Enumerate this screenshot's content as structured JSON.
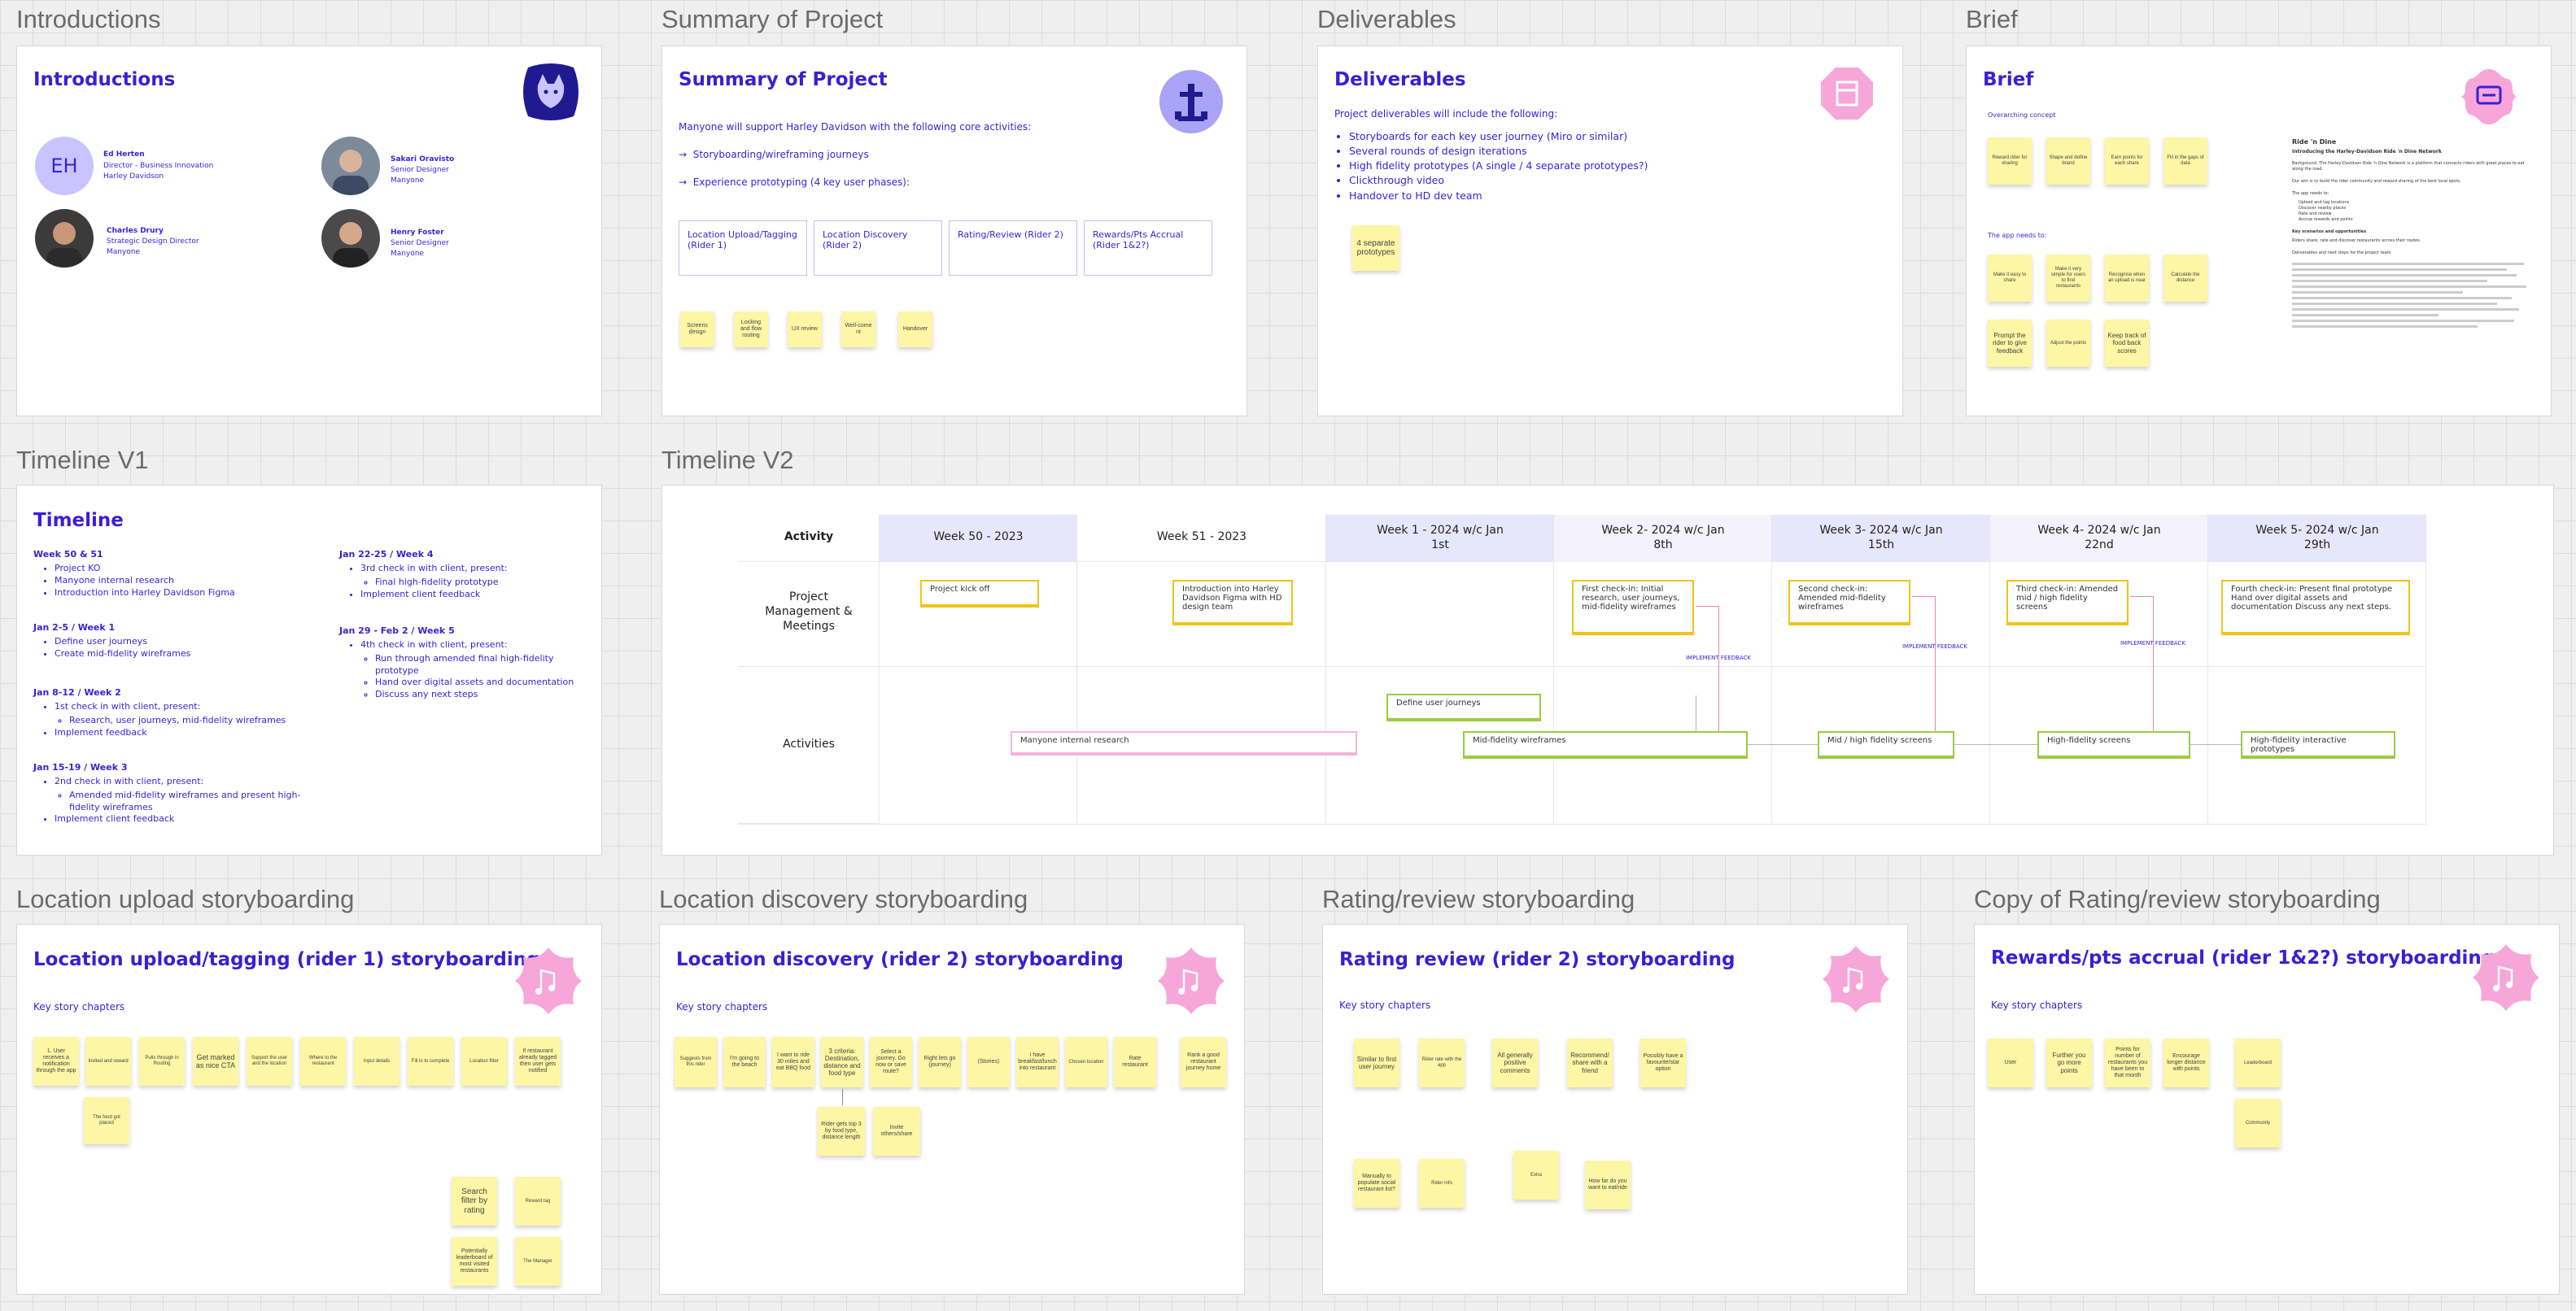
{
  "frames": {
    "intro": {
      "title": "Introductions",
      "heading": "Introductions",
      "people": [
        {
          "initials": "EH",
          "name": "Ed Herten",
          "role": "Director - Business Innovation",
          "org": "Harley Davidson"
        },
        {
          "name": "Sakari Oravisto",
          "role": "Senior Designer",
          "org": "Manyone"
        },
        {
          "name": "Charles Drury",
          "role": "Strategic Design Director",
          "org": "Manyone"
        },
        {
          "name": "Henry Foster",
          "role": "Senior Designer",
          "org": "Manyone"
        }
      ]
    },
    "summary": {
      "title": "Summary of Project",
      "heading": "Summary of Project",
      "lead": "Manyone will support Harley Davidson with the following core activities:",
      "arrows": [
        "Storyboarding/wireframing journeys",
        "Experience prototyping (4 key user phases):"
      ],
      "arrow_glyph": "→",
      "phases": [
        "Location Upload/Tagging (Rider 1)",
        "Location Discovery (Rider 2)",
        "Rating/Review (Rider 2)",
        "Rewards/Pts Accrual (Rider 1&2?)"
      ],
      "stickies": [
        "Screens design",
        "Locking and flow routing",
        "UX review",
        "Well-come nt",
        "Handover"
      ]
    },
    "deliverables": {
      "title": "Deliverables",
      "heading": "Deliverables",
      "lead": "Project deliverables will include the following:",
      "bullets": [
        "Storyboards for each key user journey (Miro or similar)",
        "Several rounds of design iterations",
        "High fidelity prototypes (A single / 4 separate prototypes?)",
        "Clickthrough video",
        "Handover to HD dev team"
      ],
      "sticky": "4 separate prototypes"
    },
    "brief": {
      "title": "Brief",
      "heading": "Brief",
      "concept_label": "Overarching concept",
      "needs_label": "The app needs to:",
      "stickies": [
        "Reward rider for sharing",
        "Shape and define brand",
        "Earn points for each share",
        "Fill in the gaps of data",
        "Make it easy to share",
        "Make it very simple for users to find restaurants",
        "Recognise when an upload is near",
        "Calculate the distance",
        "Prompt the rider to give feedback",
        "Adjust the points",
        "Keep track of food back scores"
      ],
      "doc_title": "Ride 'n Dine",
      "doc_subtitle": "Introducing the Harley-Davidson Ride 'n Dine Network",
      "doc_lines": [
        "Background: The Harley-Davidson Ride 'n Dine Network is a platform that connects riders with great places to eat along the road.",
        "Our aim is to build the rider community and reward sharing of the best local spots.",
        "The app needs to:",
        "Upload and tag locations",
        "Discover nearby places",
        "Rate and review",
        "Accrue rewards and points",
        "Key scenarios and opportunities",
        "Riders share, rate and discover restaurants across their routes.",
        "Deliverables and next steps for the project team."
      ]
    },
    "timeline1": {
      "title": "Timeline V1",
      "heading": "Timeline",
      "sections": [
        {
          "head": "Week 50 & 51",
          "items": [
            "Project KO",
            "Manyone internal research",
            "Introduction into Harley Davidson Figma"
          ]
        },
        {
          "head": "Jan 2-5 / Week 1",
          "items": [
            "Define user journeys",
            "Create mid-fidelity wireframes"
          ]
        },
        {
          "head": "Jan 8-12 / Week 2",
          "items": [
            "1st check in with client, present:",
            "Research, user journeys, mid-fidelity wireframes",
            "Implement feedback"
          ]
        },
        {
          "head": "Jan 15-19 / Week 3",
          "items": [
            "2nd check in with client, present:",
            "Amended mid-fidelity wireframes and present high-fidelity wireframes",
            "Implement client feedback"
          ]
        },
        {
          "head": "Jan 22-25 / Week 4",
          "items": [
            "3rd check in with client, present:",
            "Final high-fidelity prototype",
            "Implement client feedback"
          ]
        },
        {
          "head": "Jan 29 - Feb 2 / Week 5",
          "items": [
            "4th check in with client, present:",
            "Run through amended final high-fidelity prototype",
            "Hand over digital assets and documentation",
            "Discuss any next steps"
          ]
        }
      ]
    },
    "timeline2": {
      "title": "Timeline V2",
      "columns": [
        "Activity",
        "Week 50 - 2023",
        "Week 51 - 2023",
        "Week 1 - 2024 w/c Jan 1st",
        "Week 2- 2024 w/c Jan 8th",
        "Week 3- 2024 w/c Jan 15th",
        "Week 4- 2024 w/c Jan 22nd",
        "Week 5- 2024 w/c Jan 29th"
      ],
      "rows": [
        "Project Management & Meetings",
        "Activities"
      ],
      "meetings": [
        "Project kick off",
        "Introduction into Harley Davidson Figma with HD design team",
        "First check-in: Initial research, user journeys, mid-fidelity wireframes",
        "Second check-in: Amended mid-fidelity wireframes",
        "Third check-in: Amended mid / high fidelity screens",
        "Fourth check-in: Present final prototype Hand over digital assets and documentation Discuss any next steps."
      ],
      "activities": [
        "Define user journeys",
        "Manyone internal research",
        "Mid-fidelity wireframes",
        "Mid / high fidelity screens",
        "High-fidelity screens",
        "High-fidelity interactive prototypes"
      ],
      "feedback_label": "IMPLEMENT FEEDBACK"
    },
    "loc_upload": {
      "title": "Location upload storyboarding",
      "heading": "Location upload/tagging (rider 1) storyboarding",
      "chapters": "Key story chapters",
      "stickies": [
        "1. User receives a notification through the app",
        "Invited and reward",
        "Pulls through in Routing",
        "Get marked as nice CTA",
        "Support the user and the location",
        "Where to the restaurant",
        "Input details",
        "Fill in to complete",
        "Location filter",
        "If restaurant already tagged then user gets notified",
        "The food got placed",
        "Search filter by rating",
        "Reward tag",
        "Potentially leaderboard of most visited restaurants",
        "The Manager"
      ]
    },
    "loc_discovery": {
      "title": "Location discovery storyboarding",
      "heading": "Location discovery (rider 2) storyboarding",
      "chapters": "Key story chapters",
      "stickies": [
        "Suggests from this rider",
        "I'm going to the beach",
        "I want to ride 30 miles and eat BBQ food",
        "3 criteria: Destination, distance and food type",
        "Select a journey. Go now or save route?",
        "Right lets go (journey)",
        "(Stories)",
        "I have breakfast/lunch into restaurant",
        "Chosen location",
        "Rate restaurant",
        "Rank a good restaurant journey home",
        "Rider gets top 3 by food type, distance length",
        "Invite others/share"
      ]
    },
    "rating": {
      "title": "Rating/review storyboarding",
      "heading": "Rating review (rider 2) storyboarding",
      "chapters": "Key story chapters",
      "stickies": [
        "Similar to first user journey",
        "Rider rate with the app",
        "All generally positive comments",
        "Recommend/ share with a friend",
        "Possibly have a favourite/star option",
        "Manually to populate social restaurant list?",
        "Rider info",
        "Extra",
        "How far do you want to eat/ride"
      ]
    },
    "rewards": {
      "title": "Copy of Rating/review storyboarding",
      "heading": "Rewards/pts accrual (rider 1&2?) storyboarding",
      "chapters": "Key story chapters",
      "stickies": [
        "User",
        "Further you go more points",
        "Points for number of restaurants you have been to that month",
        "Encourage longer distance with points",
        "Leaderboard",
        "Community"
      ]
    }
  },
  "colors": {
    "accent": "#3a1fd6",
    "sticky": "#fdf6a4",
    "badge_pink": "#f7a6d9",
    "badge_navy": "#1f1a8f",
    "badge_lavender": "#a9a4f5",
    "grid_head": "#e8e6fb"
  },
  "icons": [
    "fox-icon",
    "anchor-icon",
    "box-icon",
    "chat-icon",
    "bird-icon"
  ]
}
